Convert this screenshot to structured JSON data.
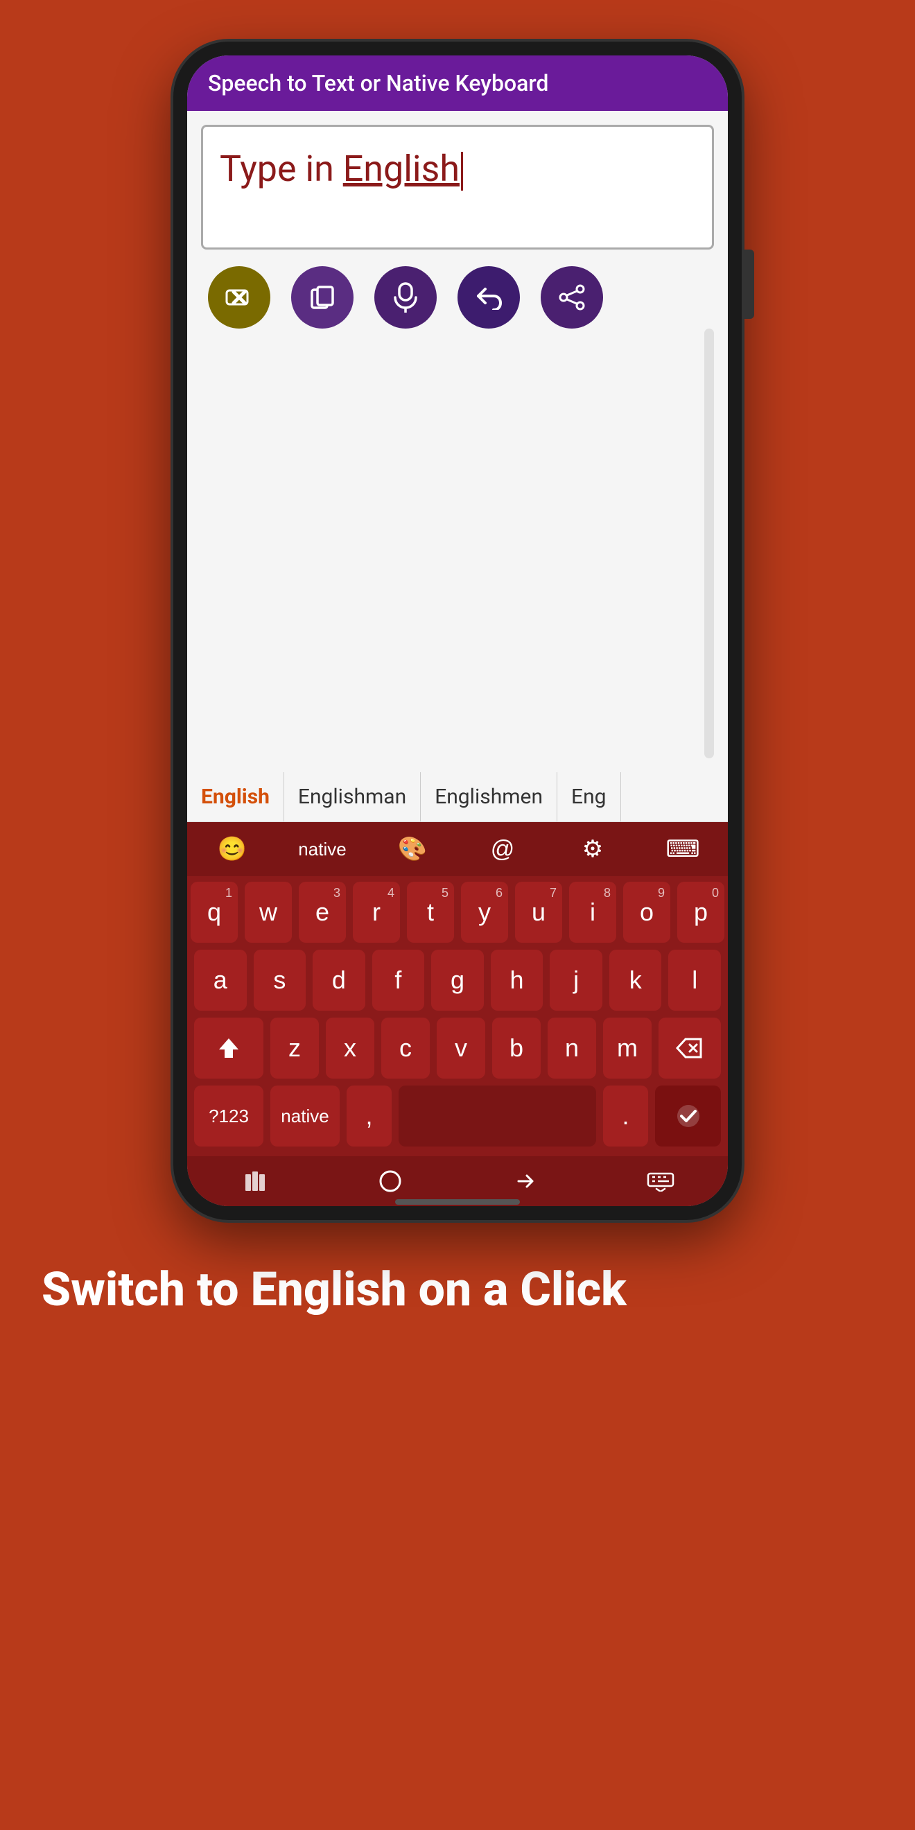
{
  "phone": {
    "title_bar": "Speech to Text or Native Keyboard",
    "input_placeholder": "Type in English",
    "input_word": "English",
    "cursor_visible": true
  },
  "action_buttons": [
    {
      "name": "delete-button",
      "icon": "✕",
      "label": "Delete",
      "class": "btn-delete"
    },
    {
      "name": "copy-button",
      "icon": "⧉",
      "label": "Copy",
      "class": "btn-copy"
    },
    {
      "name": "mic-button",
      "icon": "🎤",
      "label": "Microphone",
      "class": "btn-mic"
    },
    {
      "name": "undo-button",
      "icon": "↩",
      "label": "Undo",
      "class": "btn-undo"
    },
    {
      "name": "share-button",
      "icon": "⋮",
      "label": "Share",
      "class": "btn-share"
    }
  ],
  "suggestions": [
    {
      "text": "English",
      "active": true
    },
    {
      "text": "Englishman",
      "active": false
    },
    {
      "text": "Englishmen",
      "active": false
    },
    {
      "text": "Eng",
      "active": false
    }
  ],
  "keyboard_top": [
    {
      "name": "emoji-key",
      "label": "😊",
      "type": "emoji"
    },
    {
      "name": "native-key",
      "label": "native",
      "type": "native"
    },
    {
      "name": "palette-key",
      "label": "🎨",
      "type": "palette"
    },
    {
      "name": "at-key",
      "label": "@",
      "type": "at"
    },
    {
      "name": "settings-key",
      "label": "⚙",
      "type": "settings"
    },
    {
      "name": "keyboard-key",
      "label": "⌨",
      "type": "keyboard"
    }
  ],
  "keyboard_rows": [
    {
      "keys": [
        {
          "label": "q",
          "num": "1"
        },
        {
          "label": "w",
          "num": ""
        },
        {
          "label": "e",
          "num": "3"
        },
        {
          "label": "r",
          "num": "4"
        },
        {
          "label": "t",
          "num": "5"
        },
        {
          "label": "y",
          "num": "6"
        },
        {
          "label": "u",
          "num": "7"
        },
        {
          "label": "i",
          "num": "8"
        },
        {
          "label": "o",
          "num": "9"
        },
        {
          "label": "p",
          "num": "0"
        }
      ]
    },
    {
      "keys": [
        {
          "label": "a"
        },
        {
          "label": "s"
        },
        {
          "label": "d"
        },
        {
          "label": "f"
        },
        {
          "label": "g"
        },
        {
          "label": "h"
        },
        {
          "label": "j"
        },
        {
          "label": "k"
        },
        {
          "label": "l"
        }
      ]
    },
    {
      "keys": [
        {
          "label": "⇧",
          "wide": true
        },
        {
          "label": "z"
        },
        {
          "label": "x"
        },
        {
          "label": "c"
        },
        {
          "label": "v"
        },
        {
          "label": "b"
        },
        {
          "label": "n"
        },
        {
          "label": "m"
        },
        {
          "label": "⌫",
          "wide": true,
          "backspace": true
        }
      ]
    },
    {
      "keys": [
        {
          "label": "?123",
          "wide": true
        },
        {
          "label": "native",
          "wide": true
        },
        {
          "label": ","
        },
        {
          "label": " ",
          "space": true
        },
        {
          "label": "."
        },
        {
          "label": "✓",
          "check": true
        }
      ]
    }
  ],
  "nav_buttons": [
    {
      "name": "recent-apps-nav",
      "icon": "⫶"
    },
    {
      "name": "home-nav",
      "icon": "○"
    },
    {
      "name": "back-nav",
      "icon": "∨"
    },
    {
      "name": "keyboard-hide-nav",
      "icon": "⠿"
    }
  ],
  "bottom_text": "Switch to English on a Click"
}
